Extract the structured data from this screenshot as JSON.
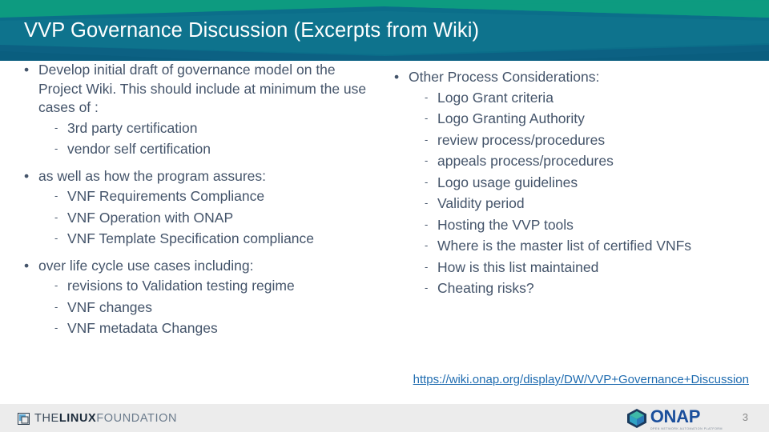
{
  "slide": {
    "title": "VVP Governance Discussion (Excerpts from Wiki)",
    "number": "3",
    "header_colors": {
      "green": "#0d9b80",
      "teal_dark": "#0b6e8a",
      "teal_mid": "#10768f",
      "blue_deep": "#0d6284"
    },
    "text_color": "#44546a",
    "link_color": "#1f6cb0",
    "footer_bg": "#ececec"
  },
  "left_column": {
    "groups": [
      {
        "bullet": "•",
        "text": "Develop initial draft of governance model on the Project Wiki. This should include at minimum the use cases of :",
        "sub_marker": "-",
        "sub_items": [
          "3rd party certification",
          "vendor self certification"
        ]
      },
      {
        "bullet": "•",
        "text": "as well as how the program assures:",
        "sub_marker": "-",
        "sub_items": [
          "VNF Requirements Compliance",
          "VNF Operation with ONAP",
          "VNF Template Specification compliance"
        ]
      },
      {
        "bullet": "•",
        "text": "over life cycle use cases including:",
        "sub_marker": "-",
        "sub_items": [
          "revisions to Validation testing regime",
          "VNF changes",
          "VNF metadata Changes"
        ]
      }
    ]
  },
  "right_column": {
    "groups": [
      {
        "bullet": "•",
        "text": "Other Process Considerations:",
        "sub_marker": "-",
        "sub_items": [
          "Logo Grant criteria",
          "Logo Granting Authority",
          "review process/procedures",
          "appeals process/procedures",
          "Logo usage guidelines",
          "Validity period",
          "Hosting the VVP tools",
          "Where is the master list of certified VNFs",
          "How is this list maintained",
          "Cheating risks?"
        ]
      }
    ]
  },
  "link": {
    "text": "https://wiki.onap.org/display/DW/VVP+Governance+Discussion"
  },
  "footer": {
    "linux_foundation": {
      "the": "THE",
      "linux": "LINUX",
      "foundation": "FOUNDATION"
    },
    "onap": {
      "name": "ONAP",
      "tagline": "OPEN NETWORK AUTOMATION PLATFORM"
    }
  }
}
